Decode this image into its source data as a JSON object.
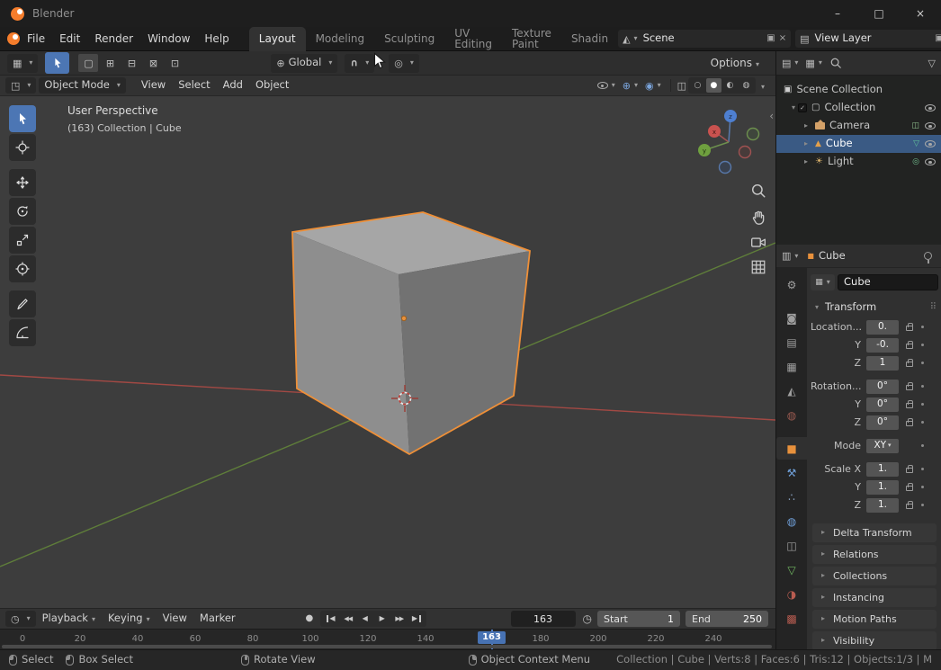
{
  "window": {
    "title": "Blender"
  },
  "colors": {
    "accent_blue": "#4772b3",
    "selection_orange": "#ef9038",
    "header_gray": "#323232",
    "viewport_gray": "#3d3d3d"
  },
  "icons": {
    "caret": "▾",
    "tri_right": "▸",
    "tri_down": "▾",
    "minimize": "–",
    "maximize": "□",
    "close": "×",
    "check": "✓",
    "collapse_left": "‹",
    "editor_3d_viewport": "▦",
    "select_modes": [
      "▢",
      "⊞",
      "⊟",
      "⊠",
      "⊡"
    ],
    "orientation_globe": "⊕",
    "snap_magnet": "∪",
    "proportional": "◎",
    "scene": "◭",
    "view_layer": "▤",
    "copy_new": "▣",
    "unlink": "×",
    "object_mode": "◳",
    "gizmos": "⊕",
    "overlays": "◉",
    "xray": "◫",
    "shading": [
      "○",
      "●",
      "◐",
      "◍"
    ],
    "editor_outliner": "▤",
    "display_mode": "▦",
    "filter_funnel": "▽",
    "scene_collection": "▣",
    "collection": "▢",
    "mesh_object": "▲",
    "mesh_data": "▽",
    "light_object": "☀",
    "light_data": "◎",
    "camera_data": "◫",
    "editor_properties": "▥",
    "object_icon": "■",
    "id_browse": "▦",
    "grip": "⠿",
    "editor_timeline": "◷",
    "record": "●",
    "jump_start": "◀",
    "prev_key": "◀◀",
    "play_back": "◀",
    "play": "▶",
    "next_key": "▶▶",
    "jump_end": "▶",
    "clock": "◷"
  },
  "topbar": {
    "menus": [
      "File",
      "Edit",
      "Render",
      "Window",
      "Help"
    ],
    "tabs": [
      "Layout",
      "Modeling",
      "Sculpting",
      "UV Editing",
      "Texture Paint",
      "Shadin"
    ],
    "scene_name": "Scene",
    "view_layer_name": "View Layer"
  },
  "tool_settings": {
    "orientation": "Global",
    "options": "Options"
  },
  "viewport": {
    "mode": "Object Mode",
    "menus": [
      "View",
      "Select",
      "Add",
      "Object"
    ],
    "overlay_title": "User Perspective",
    "overlay_subtitle": "(163) Collection | Cube",
    "axis": {
      "x": "x",
      "y": "y",
      "z": "z"
    }
  },
  "outliner": {
    "rows": [
      {
        "label": "Scene Collection"
      },
      {
        "label": "Collection"
      },
      {
        "label": "Camera"
      },
      {
        "label": "Cube"
      },
      {
        "label": "Light"
      }
    ]
  },
  "properties": {
    "tabs": [
      {
        "name": "tool",
        "glyph": "⚙"
      },
      {
        "name": "render",
        "glyph": "◙"
      },
      {
        "name": "output",
        "glyph": "▤"
      },
      {
        "name": "view-layer",
        "glyph": "▦"
      },
      {
        "name": "scene",
        "glyph": "◭"
      },
      {
        "name": "world",
        "glyph": "◍"
      },
      {
        "name": "object",
        "glyph": "■"
      },
      {
        "name": "modifiers",
        "glyph": "⚒"
      },
      {
        "name": "particles",
        "glyph": "∴"
      },
      {
        "name": "physics",
        "glyph": "◍"
      },
      {
        "name": "constraints",
        "glyph": "◫"
      },
      {
        "name": "object-data",
        "glyph": "▽"
      },
      {
        "name": "material",
        "glyph": "◑"
      },
      {
        "name": "texture",
        "glyph": "▩"
      }
    ],
    "breadcrumb": "Cube",
    "name_value": "Cube",
    "transform_title": "Transform",
    "transform_rows": [
      {
        "label": "Location...",
        "value": "0."
      },
      {
        "label": "Y",
        "value": "-0."
      },
      {
        "label": "Z",
        "value": "1"
      },
      {
        "label": "Rotation...",
        "value": "0°"
      },
      {
        "label": "Y",
        "value": "0°"
      },
      {
        "label": "Z",
        "value": "0°"
      },
      {
        "label": "Mode",
        "value": "XY"
      },
      {
        "label": "Scale X",
        "value": "1."
      },
      {
        "label": "Y",
        "value": "1."
      },
      {
        "label": "Z",
        "value": "1."
      }
    ],
    "sections": [
      "Delta Transform",
      "Relations",
      "Collections",
      "Instancing",
      "Motion Paths",
      "Visibility"
    ]
  },
  "timeline": {
    "menus": [
      "Playback",
      "Keying",
      "View",
      "Marker"
    ],
    "current_frame": "163",
    "start_label": "Start",
    "start_value": "1",
    "end_label": "End",
    "end_value": "250",
    "ticks": [
      "0",
      "20",
      "40",
      "60",
      "80",
      "100",
      "120",
      "140",
      "180",
      "200",
      "220",
      "240"
    ]
  },
  "statusbar": {
    "hints": [
      "Select",
      "Box Select",
      "Rotate View",
      "Object Context Menu"
    ],
    "stats": "Collection | Cube | Verts:8 | Faces:6 | Tris:12 | Objects:1/3 | M"
  }
}
